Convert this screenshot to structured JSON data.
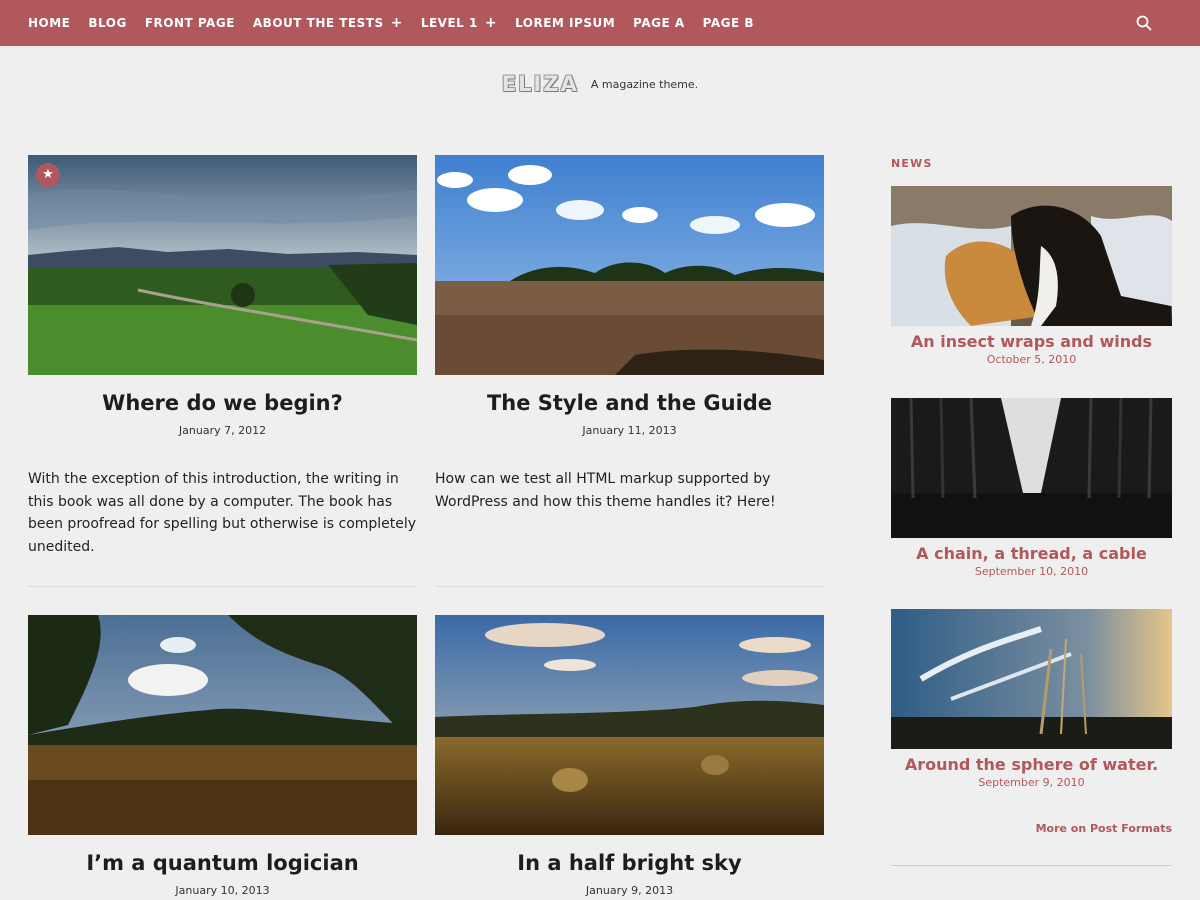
{
  "nav": {
    "items": [
      {
        "label": "HOME",
        "has_submenu": false
      },
      {
        "label": "BLOG",
        "has_submenu": false
      },
      {
        "label": "FRONT PAGE",
        "has_submenu": false
      },
      {
        "label": "ABOUT THE TESTS",
        "has_submenu": true
      },
      {
        "label": "LEVEL 1",
        "has_submenu": true
      },
      {
        "label": "LOREM IPSUM",
        "has_submenu": false
      },
      {
        "label": "PAGE A",
        "has_submenu": false
      },
      {
        "label": "PAGE B",
        "has_submenu": false
      }
    ],
    "submenu_icon": "+",
    "search_icon": "search-icon"
  },
  "site": {
    "title": "ELIZA",
    "tagline": "A magazine theme."
  },
  "posts": [
    {
      "title": "Where do we begin?",
      "date": "January 7, 2012",
      "excerpt": "With the exception of this introduction, the writing in this book was all done by a computer. The book has been proofread for spelling but otherwise is completely unedited.",
      "featured": true,
      "featured_icon": "★"
    },
    {
      "title": "The Style and the Guide",
      "date": "January 11, 2013",
      "excerpt": "How can we test all HTML markup supported by WordPress and how this theme handles it? Here!"
    },
    {
      "title": "I’m a quantum logician",
      "date": "January 10, 2013"
    },
    {
      "title": "In a half bright sky",
      "date": "January 9, 2013"
    }
  ],
  "sidebar": {
    "widget_title": "NEWS",
    "posts": [
      {
        "title": "An insect wraps and winds",
        "date": "October 5, 2010"
      },
      {
        "title": "A chain, a thread, a cable",
        "date": "September 10, 2010"
      },
      {
        "title": "Around the sphere of water.",
        "date": "September 9, 2010"
      }
    ],
    "more_link": "More on Post Formats"
  },
  "colors": {
    "accent": "#b0585b",
    "background": "#f0efef"
  }
}
